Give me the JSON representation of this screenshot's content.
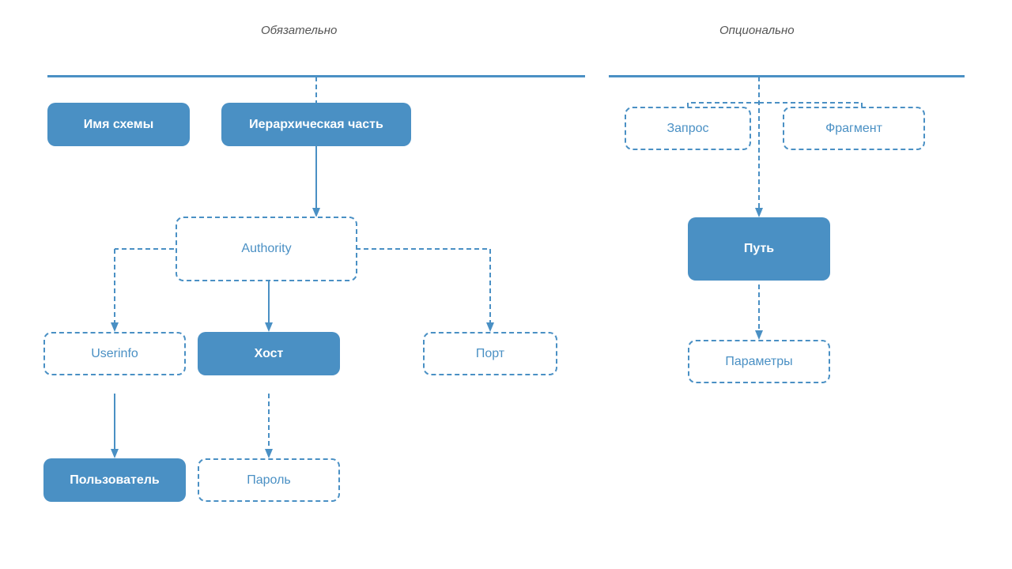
{
  "labels": {
    "mandatory": "Обязательно",
    "optional": "Опционально"
  },
  "nodes": {
    "schema_name": "Имя схемы",
    "hierarchical_part": "Иерархическая часть",
    "authority": "Authority",
    "userinfo": "Userinfo",
    "host": "Хост",
    "port": "Порт",
    "user": "Пользователь",
    "password": "Пароль",
    "query": "Запрос",
    "fragment": "Фрагмент",
    "path": "Путь",
    "params": "Параметры"
  }
}
